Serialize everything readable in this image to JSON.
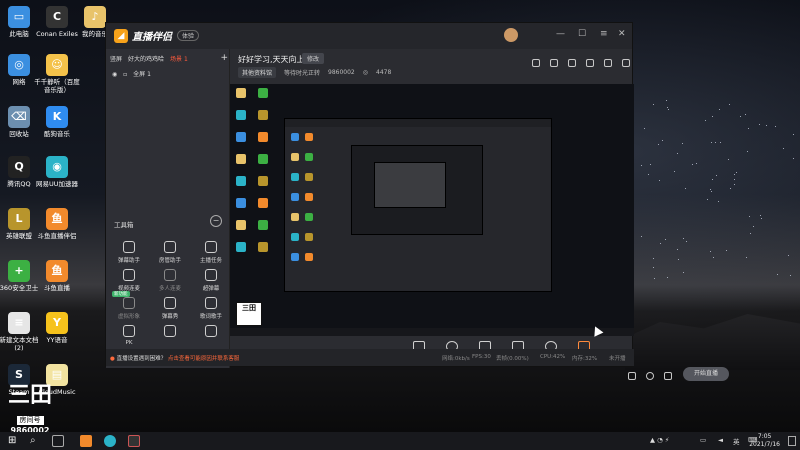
{
  "desktop": {
    "icons": [
      {
        "label": "此电脑",
        "color": "#3b8fe0",
        "glyph": "▭"
      },
      {
        "label": "Conan Exiles",
        "color": "#333",
        "glyph": "C"
      },
      {
        "label": "我的音乐",
        "color": "#e8c36a",
        "glyph": "♪"
      },
      {
        "label": "网络",
        "color": "#3b8fe0",
        "glyph": "◎"
      },
      {
        "label": "千千静听（百度音乐版）",
        "color": "#f4c24a",
        "glyph": "☺"
      },
      {
        "label": "回收站",
        "color": "#6c8fb0",
        "glyph": "⌫"
      },
      {
        "label": "酷狗音乐",
        "color": "#2f8cf0",
        "glyph": "K"
      },
      {
        "label": "腾讯QQ",
        "color": "#222",
        "glyph": "Q"
      },
      {
        "label": "网易UU加速器",
        "color": "#2bb3c8",
        "glyph": "◉"
      },
      {
        "label": "英雄联盟",
        "color": "#b8952c",
        "glyph": "L"
      },
      {
        "label": "斗鱼直播伴侣",
        "color": "#f28a2c",
        "glyph": "鱼"
      },
      {
        "label": "360安全卫士",
        "color": "#3cb043",
        "glyph": "+"
      },
      {
        "label": "斗鱼直播",
        "color": "#f28a2c",
        "glyph": "鱼"
      },
      {
        "label": "新建文本文档 (2)",
        "color": "#e6e6e6",
        "glyph": "≡"
      },
      {
        "label": "YY语音",
        "color": "#f6c21c",
        "glyph": "Y"
      },
      {
        "label": "Steam",
        "color": "#1b2838",
        "glyph": "S"
      },
      {
        "label": "CloudMusic",
        "color": "#f2e3a0",
        "glyph": "▤"
      }
    ],
    "fang": {
      "big": "三田",
      "label": "房间号",
      "number": "9860002"
    }
  },
  "app": {
    "logo_text": "直播伴侣",
    "version_badge": "体验",
    "window_controls": [
      "—",
      "☐",
      "✕"
    ],
    "scene_tabs": {
      "tab1": "竖屏",
      "tab2": "好大的鸡鸡哈",
      "tab3": "场景 1",
      "add": "+"
    },
    "scene_item": "全屏 1",
    "room": {
      "title": "好好学习,天天向上",
      "edit_label": "修改",
      "category": "其他资料馆",
      "room_label": "等待时光正转",
      "room_id": "9860002",
      "hot": "4478"
    },
    "tools_title": "工具箱",
    "tools_minimize": "−",
    "tools": [
      {
        "label": "弹幕助手",
        "dim": false,
        "badge": ""
      },
      {
        "label": "房管助手",
        "dim": false,
        "badge": ""
      },
      {
        "label": "主播任务",
        "dim": false,
        "badge": ""
      },
      {
        "label": "视频连麦",
        "dim": false,
        "badge": ""
      },
      {
        "label": "多人连麦",
        "dim": true,
        "badge": ""
      },
      {
        "label": "超弹幕",
        "dim": false,
        "badge": ""
      },
      {
        "label": "虚拟形象",
        "dim": true,
        "badge": "新功能"
      },
      {
        "label": "弹幕秀",
        "dim": false,
        "badge": ""
      },
      {
        "label": "歌词歌手",
        "dim": false,
        "badge": ""
      },
      {
        "label": "PK",
        "dim": false,
        "badge": ""
      },
      {
        "label": "",
        "dim": false,
        "badge": ""
      },
      {
        "label": "",
        "dim": false,
        "badge": ""
      }
    ],
    "controls": [
      {
        "label": "直播屏幕",
        "shape": "square"
      },
      {
        "label": "摄像头",
        "shape": "round"
      },
      {
        "label": "手机投屏",
        "shape": "square"
      },
      {
        "label": "多媒体",
        "shape": "square"
      },
      {
        "label": "麦克风",
        "shape": "round"
      },
      {
        "label": "扬声器",
        "shape": "orange"
      }
    ],
    "live_button": "开始直播",
    "status": {
      "notice_prefix": "直播设置遇到困难？",
      "notice_link": "点击查看可能原因并联系客服",
      "net": "网络:0kb/s",
      "fps": "FPS:30",
      "drop": "丢帧(0.00%)",
      "cpu": "CPU:42%",
      "mem": "内存:32%",
      "rec": "未开播"
    }
  },
  "taskbar": {
    "tray_lang": "英",
    "time": "7:05",
    "date": "2021/7/16"
  }
}
